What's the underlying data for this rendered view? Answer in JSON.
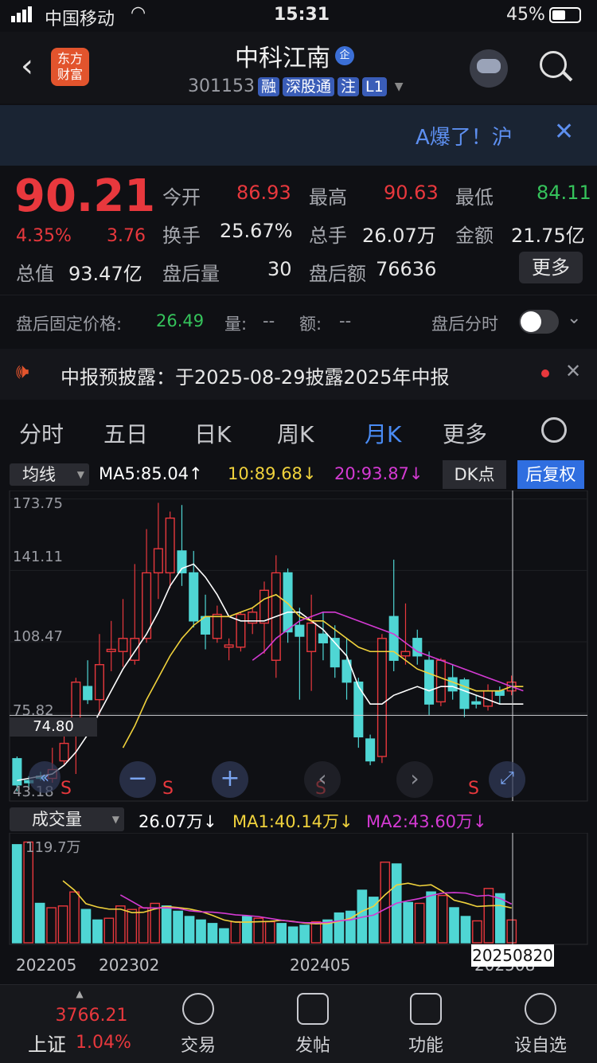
{
  "status_bar": {
    "carrier": "中国移动",
    "time": "15:31",
    "battery": "45%"
  },
  "header": {
    "title": "中科江南",
    "badge": "企",
    "code": "301153",
    "tags": [
      "融",
      "深股通",
      "注",
      "L1"
    ],
    "logo_line1": "东方",
    "logo_line2": "财富"
  },
  "banner": {
    "text": "A爆了！沪"
  },
  "quote": {
    "price": "90.21",
    "pct": "4.35%",
    "chg": "3.76",
    "open_label": "今开",
    "open": "86.93",
    "high_label": "最高",
    "high": "90.63",
    "low_label": "最低",
    "low": "84.11",
    "turnover_label": "换手",
    "turnover": "25.67%",
    "volume_label": "总手",
    "volume": "26.07万",
    "amount_label": "金额",
    "amount": "21.75亿",
    "mcap_label": "总值",
    "mcap": "93.47亿",
    "ah_vol_label": "盘后量",
    "ah_vol": "30",
    "ah_amt_label": "盘后额",
    "ah_amt": "76636",
    "more_label": "更多"
  },
  "after_hours": {
    "price_label": "盘后固定价格:",
    "price": "26.49",
    "vol_label": "量:",
    "vol": "--",
    "amt_label": "额:",
    "amt": "--",
    "timeshare_label": "盘后分时"
  },
  "notice": {
    "text": "中报预披露：于2025-08-29披露2025年中报"
  },
  "tabs": {
    "items": [
      "分时",
      "五日",
      "日K",
      "周K",
      "月K",
      "更多"
    ],
    "active": "月K"
  },
  "ma_bar": {
    "selector": "均线",
    "ma5": "MA5:85.04↑",
    "ma10": "10:89.68↓",
    "ma20": "20:93.87↓",
    "dk": "DK点",
    "fq": "后复权"
  },
  "price_axis": {
    "labels": [
      "173.75",
      "141.11",
      "108.47",
      "75.82",
      "43.18"
    ],
    "crosshair": "74.80"
  },
  "vol_bar": {
    "selector": "成交量",
    "vol": "26.07万↓",
    "ma1": "MA1:40.14万↓",
    "ma2": "MA2:43.60万↓",
    "max": "119.7万"
  },
  "x_axis": {
    "labels": [
      "202205",
      "202302",
      "202405",
      "20250820",
      "202508"
    ]
  },
  "markers": {
    "s": "S"
  },
  "colors": {
    "up": "#e8383d",
    "down": "#4fd6d4",
    "ma5": "#ffffff",
    "ma10": "#f0d23c",
    "ma20": "#d43ad3"
  },
  "candles": [
    {
      "o": 55,
      "c": 43,
      "h": 56,
      "l": 40
    },
    {
      "o": 45,
      "c": 44,
      "h": 47,
      "l": 42
    },
    {
      "o": 47,
      "c": 46,
      "h": 49,
      "l": 45
    },
    {
      "o": 46,
      "c": 50,
      "h": 60,
      "l": 44
    },
    {
      "o": 54,
      "c": 62,
      "h": 66,
      "l": 52
    },
    {
      "o": 70,
      "c": 90,
      "h": 92,
      "l": 48
    },
    {
      "o": 88,
      "c": 82,
      "h": 100,
      "l": 80
    },
    {
      "o": 82,
      "c": 98,
      "h": 112,
      "l": 75
    },
    {
      "o": 104,
      "c": 105,
      "h": 118,
      "l": 95
    },
    {
      "o": 104,
      "c": 110,
      "h": 128,
      "l": 97
    },
    {
      "o": 100,
      "c": 110,
      "h": 144,
      "l": 98
    },
    {
      "o": 110,
      "c": 140,
      "h": 160,
      "l": 108
    },
    {
      "o": 140,
      "c": 151,
      "h": 172,
      "l": 128
    },
    {
      "o": 140,
      "c": 165,
      "h": 168,
      "l": 133
    },
    {
      "o": 150,
      "c": 140,
      "h": 171,
      "l": 134
    },
    {
      "o": 140,
      "c": 118,
      "h": 150,
      "l": 115
    },
    {
      "o": 120,
      "c": 112,
      "h": 130,
      "l": 105
    },
    {
      "o": 110,
      "c": 121,
      "h": 125,
      "l": 108
    },
    {
      "o": 106,
      "c": 107,
      "h": 110,
      "l": 100
    },
    {
      "o": 106,
      "c": 121,
      "h": 122,
      "l": 104
    },
    {
      "o": 117,
      "c": 122,
      "h": 124,
      "l": 112
    },
    {
      "o": 117,
      "c": 132,
      "h": 136,
      "l": 103
    },
    {
      "o": 100,
      "c": 140,
      "h": 148,
      "l": 92
    },
    {
      "o": 140,
      "c": 113,
      "h": 142,
      "l": 108
    },
    {
      "o": 116,
      "c": 111,
      "h": 124,
      "l": 82
    },
    {
      "o": 104,
      "c": 117,
      "h": 130,
      "l": 86
    },
    {
      "o": 112,
      "c": 108,
      "h": 122,
      "l": 100
    },
    {
      "o": 110,
      "c": 97,
      "h": 116,
      "l": 92
    },
    {
      "o": 100,
      "c": 90,
      "h": 110,
      "l": 82
    },
    {
      "o": 90,
      "c": 65,
      "h": 92,
      "l": 60
    },
    {
      "o": 64,
      "c": 54,
      "h": 66,
      "l": 52
    },
    {
      "o": 56,
      "c": 110,
      "h": 112,
      "l": 53
    },
    {
      "o": 120,
      "c": 100,
      "h": 146,
      "l": 95
    },
    {
      "o": 102,
      "c": 104,
      "h": 126,
      "l": 98
    },
    {
      "o": 110,
      "c": 102,
      "h": 114,
      "l": 98
    },
    {
      "o": 100,
      "c": 80,
      "h": 104,
      "l": 75
    },
    {
      "o": 81,
      "c": 100,
      "h": 101,
      "l": 79
    },
    {
      "o": 92,
      "c": 86,
      "h": 98,
      "l": 82
    },
    {
      "o": 91,
      "c": 78,
      "h": 92,
      "l": 74
    },
    {
      "o": 81,
      "c": 80,
      "h": 84,
      "l": 78
    },
    {
      "o": 79,
      "c": 86,
      "h": 89,
      "l": 77
    },
    {
      "o": 86,
      "c": 84,
      "h": 88,
      "l": 80
    },
    {
      "o": 86,
      "c": 90,
      "h": 93,
      "l": 84
    }
  ],
  "volumes": [
    {
      "v": 112,
      "up": false
    },
    {
      "v": 115,
      "up": true
    },
    {
      "v": 45,
      "up": false
    },
    {
      "v": 40,
      "up": true
    },
    {
      "v": 42,
      "up": true
    },
    {
      "v": 58,
      "up": true
    },
    {
      "v": 38,
      "up": false
    },
    {
      "v": 26,
      "up": false
    },
    {
      "v": 28,
      "up": true
    },
    {
      "v": 42,
      "up": true
    },
    {
      "v": 38,
      "up": true
    },
    {
      "v": 40,
      "up": true
    },
    {
      "v": 45,
      "up": true
    },
    {
      "v": 42,
      "up": false
    },
    {
      "v": 36,
      "up": false
    },
    {
      "v": 30,
      "up": false
    },
    {
      "v": 26,
      "up": false
    },
    {
      "v": 22,
      "up": false
    },
    {
      "v": 16,
      "up": false
    },
    {
      "v": 24,
      "up": true
    },
    {
      "v": 30,
      "up": false
    },
    {
      "v": 28,
      "up": true
    },
    {
      "v": 24,
      "up": true
    },
    {
      "v": 22,
      "up": false
    },
    {
      "v": 18,
      "up": false
    },
    {
      "v": 20,
      "up": false
    },
    {
      "v": 24,
      "up": true
    },
    {
      "v": 26,
      "up": false
    },
    {
      "v": 34,
      "up": false
    },
    {
      "v": 36,
      "up": false
    },
    {
      "v": 60,
      "up": false
    },
    {
      "v": 52,
      "up": false
    },
    {
      "v": 92,
      "up": true
    },
    {
      "v": 90,
      "up": false
    },
    {
      "v": 46,
      "up": false
    },
    {
      "v": 45,
      "up": true
    },
    {
      "v": 58,
      "up": false
    },
    {
      "v": 54,
      "up": true
    },
    {
      "v": 40,
      "up": false
    },
    {
      "v": 30,
      "up": false
    },
    {
      "v": 25,
      "up": true
    },
    {
      "v": 62,
      "up": true
    },
    {
      "v": 56,
      "up": false
    },
    {
      "v": 26,
      "up": true
    }
  ],
  "ma5_line": [
    45,
    46,
    47,
    48,
    52,
    58,
    66,
    76,
    86,
    96,
    104,
    112,
    122,
    134,
    142,
    144,
    138,
    130,
    120,
    118,
    118,
    118,
    120,
    122,
    122,
    118,
    114,
    108,
    102,
    88,
    80,
    80,
    84,
    86,
    88,
    86,
    88,
    88,
    86,
    84,
    82,
    80,
    80,
    80
  ],
  "ma10_line": [
    null,
    null,
    null,
    null,
    null,
    null,
    null,
    null,
    null,
    60,
    70,
    82,
    92,
    102,
    110,
    116,
    120,
    120,
    120,
    122,
    124,
    128,
    130,
    126,
    120,
    118,
    118,
    114,
    110,
    106,
    104,
    104,
    104,
    100,
    96,
    94,
    92,
    90,
    88,
    86,
    86,
    86,
    88,
    88
  ],
  "ma20_line": [
    null,
    null,
    null,
    null,
    null,
    null,
    null,
    null,
    null,
    null,
    null,
    null,
    null,
    null,
    null,
    null,
    null,
    null,
    null,
    null,
    100,
    104,
    110,
    114,
    118,
    120,
    122,
    122,
    120,
    118,
    116,
    114,
    112,
    108,
    104,
    102,
    100,
    98,
    96,
    94,
    92,
    90,
    88,
    86
  ]
}
